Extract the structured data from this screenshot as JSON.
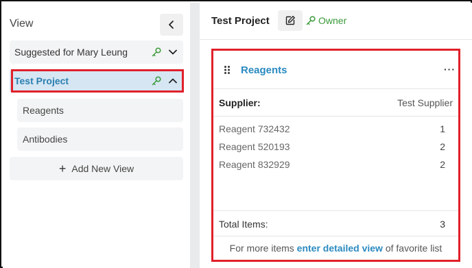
{
  "sidebar": {
    "title": "View",
    "collapse_icon": "chevron-left-icon",
    "views": [
      {
        "label": "Suggested for Mary Leung",
        "key_icon": "key-icon",
        "chevron": "chevron-down-icon"
      },
      {
        "label": "Test Project",
        "key_icon": "key-icon",
        "chevron": "chevron-up-icon"
      }
    ],
    "subviews": [
      {
        "label": "Reagents"
      },
      {
        "label": "Antibodies"
      }
    ],
    "add_view_label": "Add New View"
  },
  "project": {
    "title": "Test Project",
    "edit_icon": "edit-icon",
    "owner_label": "Owner"
  },
  "card": {
    "title": "Reagents",
    "more_label": "···",
    "supplier_label": "Supplier:",
    "supplier_value": "Test Supplier",
    "items": [
      {
        "name": "Reagent 732432",
        "qty": "1"
      },
      {
        "name": "Reagent 520193",
        "qty": "2"
      },
      {
        "name": "Reagent 832929",
        "qty": "2"
      }
    ],
    "total_label": "Total Items:",
    "total_value": "3",
    "footer_prefix": "For more items",
    "footer_link": "enter detailed view",
    "footer_suffix": "of favorite list"
  },
  "colors": {
    "accent_blue": "#2a8ac0",
    "highlight_red": "#e0202a",
    "key_green": "#3a9a3a",
    "selected_bg": "#d6e6f3"
  }
}
